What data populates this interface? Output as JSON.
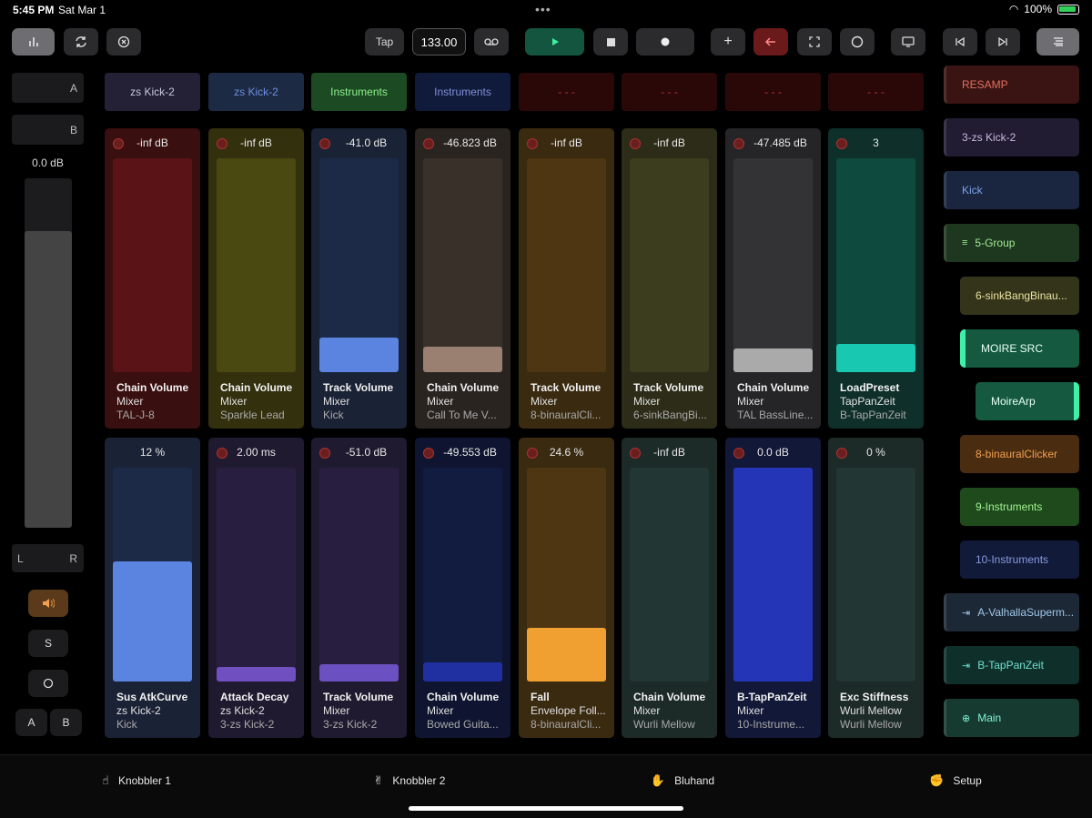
{
  "status": {
    "time": "5:45 PM",
    "date": "Sat Mar 1",
    "battery": "100%"
  },
  "toolbar": {
    "tap_label": "Tap",
    "bpm": "133.00",
    "icons": [
      "mixer-icon",
      "loop-icon",
      "close-circle-icon",
      "tape-icon",
      "play-icon",
      "stop-icon",
      "record-icon",
      "plus-icon",
      "back-arrow-icon",
      "fullscreen-icon",
      "circle-icon",
      "screen-icon",
      "skip-back-icon",
      "skip-forward-icon",
      "menu-icon"
    ]
  },
  "left": {
    "send_a": "A",
    "send_b": "B",
    "volume": "0.0 dB",
    "volume_level": 0.85,
    "pan_left": "L",
    "pan_right": "R",
    "solo": "S",
    "xfade_a": "A",
    "xfade_b": "B"
  },
  "headers": [
    {
      "label": "zs Kick-2",
      "bg": "#242136",
      "fg": "#c8c8dc"
    },
    {
      "label": "zs Kick-2",
      "bg": "#1d2a44",
      "fg": "#6b8fe0"
    },
    {
      "label": "Instruments",
      "bg": "#1c4a22",
      "fg": "#8ef08e"
    },
    {
      "label": "Instruments",
      "bg": "#101a3a",
      "fg": "#8090d8"
    },
    {
      "label": "- - -",
      "bg": "#2a0808",
      "fg": "#c03030"
    },
    {
      "label": "- - -",
      "bg": "#2a0808",
      "fg": "#c03030"
    },
    {
      "label": "- - -",
      "bg": "#2a0808",
      "fg": "#c03030"
    },
    {
      "label": "- - -",
      "bg": "#2a0808",
      "fg": "#c03030"
    }
  ],
  "rows": [
    [
      {
        "value": "-inf dB",
        "dot": true,
        "level": 0,
        "l1": "Chain Volume",
        "l2": "Mixer",
        "l3": "TAL-J-8",
        "bg": "#3a0f10",
        "track": "#5a1316",
        "fill": "#7a1a1c"
      },
      {
        "value": "-inf dB",
        "dot": true,
        "level": 0,
        "l1": "Chain Volume",
        "l2": "Mixer",
        "l3": "Sparkle Lead",
        "bg": "#33300e",
        "track": "#4b4912",
        "fill": "#66641a"
      },
      {
        "value": "-41.0 dB",
        "dot": true,
        "level": 0.16,
        "l1": "Track Volume",
        "l2": "Mixer",
        "l3": "Kick",
        "bg": "#1a2235",
        "track": "#1c2a48",
        "fill": "#5a84e0"
      },
      {
        "value": "-46.823 dB",
        "dot": true,
        "level": 0.12,
        "l1": "Chain Volume",
        "l2": "Mixer",
        "l3": "Call To Me V...",
        "bg": "#2a2420",
        "track": "#3a302a",
        "fill": "#9a8070"
      },
      {
        "value": "-inf dB",
        "dot": true,
        "level": 0,
        "l1": "Track Volume",
        "l2": "Mixer",
        "l3": "8-binauralCli...",
        "bg": "#3a2a10",
        "track": "#4e3612",
        "fill": "#6e4e1a"
      },
      {
        "value": "-inf dB",
        "dot": true,
        "level": 0,
        "l1": "Track Volume",
        "l2": "Mixer",
        "l3": "6-sinkBangBi...",
        "bg": "#2c2c18",
        "track": "#3c3c1e",
        "fill": "#55552a"
      },
      {
        "value": "-47.485 dB",
        "dot": true,
        "level": 0.11,
        "l1": "Chain Volume",
        "l2": "Mixer",
        "l3": "TAL BassLine...",
        "bg": "#252527",
        "track": "#333336",
        "fill": "#aaaaaa"
      },
      {
        "value": "3",
        "dot": true,
        "level": 0.13,
        "l1": "LoadPreset",
        "l2": "TapPanZeit",
        "l3": "B-TapPanZeit",
        "bg": "#0f302a",
        "track": "#0e4a3e",
        "fill": "#18c8b0"
      }
    ],
    [
      {
        "value": "12 %",
        "dot": false,
        "level": 0.56,
        "l1": "Sus AtkCurve",
        "l2": "zs Kick-2",
        "l3": "Kick",
        "bg": "#1a2235",
        "track": "#1c2a48",
        "fill": "#5a84e0"
      },
      {
        "value": "2.00 ms",
        "dot": true,
        "level": 0.07,
        "l1": "Attack Decay",
        "l2": "zs Kick-2",
        "l3": "3-zs Kick-2",
        "bg": "#201a30",
        "track": "#281f40",
        "fill": "#7050c0"
      },
      {
        "value": "-51.0 dB",
        "dot": true,
        "level": 0.08,
        "l1": "Track Volume",
        "l2": "Mixer",
        "l3": "3-zs Kick-2",
        "bg": "#201a30",
        "track": "#281f40",
        "fill": "#6a50c0"
      },
      {
        "value": "-49.553 dB",
        "dot": true,
        "level": 0.09,
        "l1": "Chain Volume",
        "l2": "Mixer",
        "l3": "Bowed Guita...",
        "bg": "#0f1530",
        "track": "#111c40",
        "fill": "#2030a0"
      },
      {
        "value": "24.6 %",
        "dot": true,
        "level": 0.25,
        "l1": "Fall",
        "l2": "Envelope Foll...",
        "l3": "8-binauralCli...",
        "bg": "#3a2a10",
        "track": "#4e3612",
        "fill": "#f0a030"
      },
      {
        "value": "-inf dB",
        "dot": true,
        "level": 0,
        "l1": "Chain Volume",
        "l2": "Mixer",
        "l3": "Wurli Mellow",
        "bg": "#1c2a28",
        "track": "#223634",
        "fill": "#2a4240"
      },
      {
        "value": "0.0 dB",
        "dot": true,
        "level": 1.0,
        "l1": "B-TapPanZeit",
        "l2": "Mixer",
        "l3": "10-Instrume...",
        "bg": "#121838",
        "track": "#18204a",
        "fill": "#2535b8"
      },
      {
        "value": "0 %",
        "dot": true,
        "level": 0,
        "l1": "Exc Stiffness",
        "l2": "Wurli Mellow",
        "l3": "Wurli Mellow",
        "bg": "#1c2a28",
        "track": "#223634",
        "fill": "#2a4240"
      }
    ]
  ],
  "tracks": [
    {
      "label": "RESAMP",
      "icon": "",
      "bg": "#3a1412",
      "fg": "#e07060",
      "indent": 0,
      "border": ""
    },
    {
      "label": "3-zs Kick-2",
      "icon": "",
      "bg": "#221c32",
      "fg": "#c8b8e0",
      "indent": 0,
      "border": ""
    },
    {
      "label": "Kick",
      "icon": "",
      "bg": "#1a2640",
      "fg": "#7ea0e8",
      "indent": 0,
      "border": ""
    },
    {
      "label": "5-Group",
      "icon": "≡",
      "bg": "#1e3820",
      "fg": "#a0e890",
      "indent": 0,
      "border": ""
    },
    {
      "label": "6-sinkBangBinau...",
      "icon": "",
      "bg": "#34341a",
      "fg": "#e8e0a0",
      "indent": 1,
      "border": ""
    },
    {
      "label": "MOIRE SRC",
      "icon": "",
      "bg": "#155a40",
      "fg": "#e8fff4",
      "indent": 1,
      "border": "left"
    },
    {
      "label": "MoireArp",
      "icon": "",
      "bg": "#155a40",
      "fg": "#e8fff4",
      "indent": 2,
      "border": "right"
    },
    {
      "label": "8-binauralClicker",
      "icon": "",
      "bg": "#4a2c10",
      "fg": "#f0a050",
      "indent": 1,
      "border": ""
    },
    {
      "label": "9-Instruments",
      "icon": "",
      "bg": "#1f4a1c",
      "fg": "#a0f090",
      "indent": 1,
      "border": ""
    },
    {
      "label": "10-Instruments",
      "icon": "",
      "bg": "#111a38",
      "fg": "#8a9ae0",
      "indent": 1,
      "border": ""
    },
    {
      "label": "A-ValhallaSuperm...",
      "icon": "⇥",
      "bg": "#1c2836",
      "fg": "#a0c8e8",
      "indent": 0,
      "border": ""
    },
    {
      "label": "B-TapPanZeit",
      "icon": "⇥",
      "bg": "#0f302a",
      "fg": "#70e0d0",
      "indent": 0,
      "border": ""
    },
    {
      "label": "Main",
      "icon": "⊕",
      "bg": "#163a30",
      "fg": "#80f0d0",
      "indent": 0,
      "border": ""
    }
  ],
  "tabs": [
    {
      "emoji": "☝",
      "label": "Knobbler 1",
      "active": true
    },
    {
      "emoji": "✌",
      "label": "Knobbler 2",
      "active": false
    },
    {
      "emoji": "✋",
      "label": "Bluhand",
      "active": false
    },
    {
      "emoji": "✊",
      "label": "Setup",
      "active": false
    }
  ]
}
